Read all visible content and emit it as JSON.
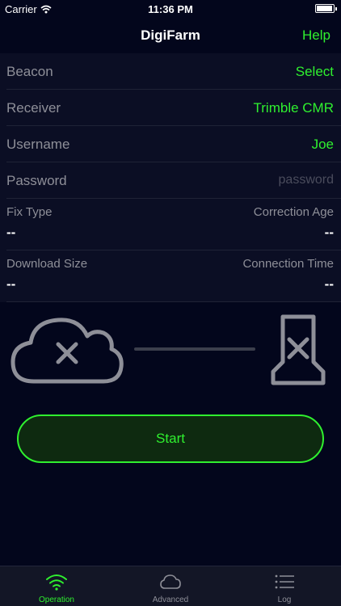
{
  "status_bar": {
    "carrier": "Carrier",
    "time": "11:36 PM"
  },
  "nav": {
    "title": "DigiFarm",
    "help": "Help"
  },
  "form": {
    "beacon": {
      "label": "Beacon",
      "value": "Select"
    },
    "receiver": {
      "label": "Receiver",
      "value": "Trimble CMR"
    },
    "username": {
      "label": "Username",
      "value": "Joe"
    },
    "password": {
      "label": "Password",
      "placeholder": "password"
    }
  },
  "info": {
    "fix_type": {
      "label": "Fix Type",
      "value": "--"
    },
    "correction_age": {
      "label": "Correction Age",
      "value": "--"
    },
    "download_size": {
      "label": "Download Size",
      "value": "--"
    },
    "connection_time": {
      "label": "Connection Time",
      "value": "--"
    }
  },
  "status_graphic": {
    "cloud_icon": "cloud-disconnected-icon",
    "receiver_icon": "receiver-disconnected-icon"
  },
  "actions": {
    "start": "Start"
  },
  "tabs": [
    {
      "label": "Operation",
      "icon": "wifi-icon",
      "active": true
    },
    {
      "label": "Advanced",
      "icon": "cloud-icon",
      "active": false
    },
    {
      "label": "Log",
      "icon": "list-icon",
      "active": false
    }
  ],
  "colors": {
    "accent": "#2ff02f",
    "background": "#03061c",
    "form_background": "#0b0e24",
    "muted": "#8e8f98"
  }
}
